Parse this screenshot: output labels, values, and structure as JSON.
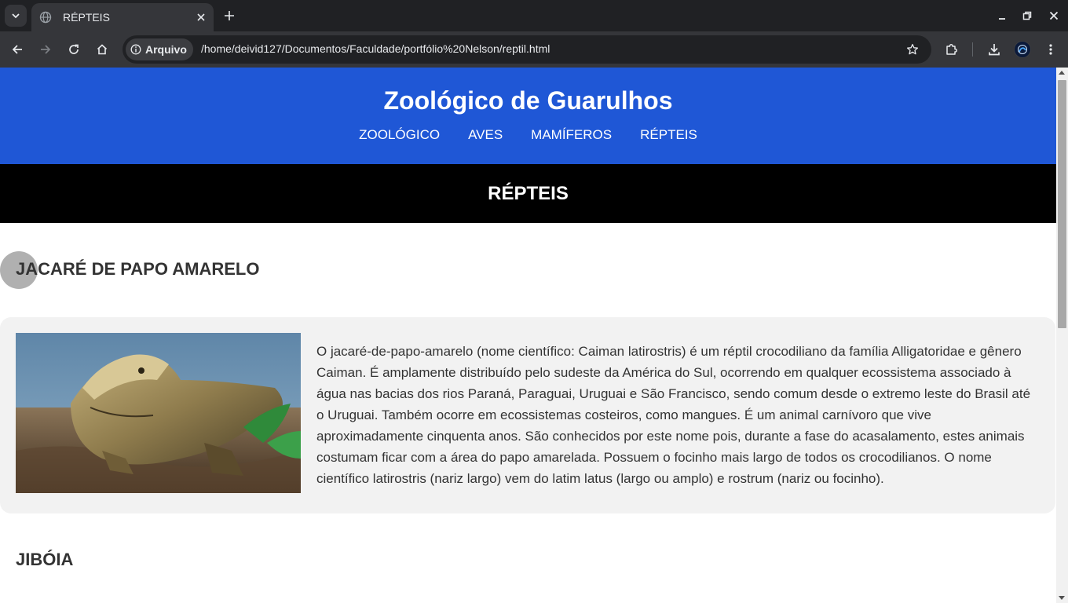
{
  "browser": {
    "tab_title": "RÉPTEIS",
    "site_info_label": "Arquivo",
    "url": "/home/deivid127/Documentos/Faculdade/portfólio%20Nelson/reptil.html"
  },
  "site": {
    "title": "Zoológico de Guarulhos",
    "nav": [
      "ZOOLÓGICO",
      "AVES",
      "MAMÍFEROS",
      "RÉPTEIS"
    ],
    "page_heading": "RÉPTEIS"
  },
  "animals": [
    {
      "name": "JACARÉ DE PAPO AMARELO",
      "description": "O jacaré-de-papo-amarelo (nome científico: Caiman latirostris) é um réptil crocodiliano da família Alligatoridae e gênero Caiman. É amplamente distribuído pelo sudeste da América do Sul, ocorrendo em qualquer ecossistema associado à água nas bacias dos rios Paraná, Paraguai, Uruguai e São Francisco, sendo comum desde o extremo leste do Brasil até o Uruguai. Também ocorre em ecossistemas costeiros, como mangues. É um animal carnívoro que vive aproximadamente cinquenta anos. São conhecidos por este nome pois, durante a fase do acasalamento, estes animais costumam ficar com a área do papo amarelada. Possuem o focinho mais largo de todos os crocodilianos. O nome científico latirostris (nariz largo) vem do latim latus (largo ou amplo) e rostrum (nariz ou focinho)."
    },
    {
      "name": "JIBÓIA"
    }
  ],
  "colors": {
    "header_blue": "#1f57d6",
    "banner_black": "#000000",
    "card_bg": "#f2f2f2"
  }
}
